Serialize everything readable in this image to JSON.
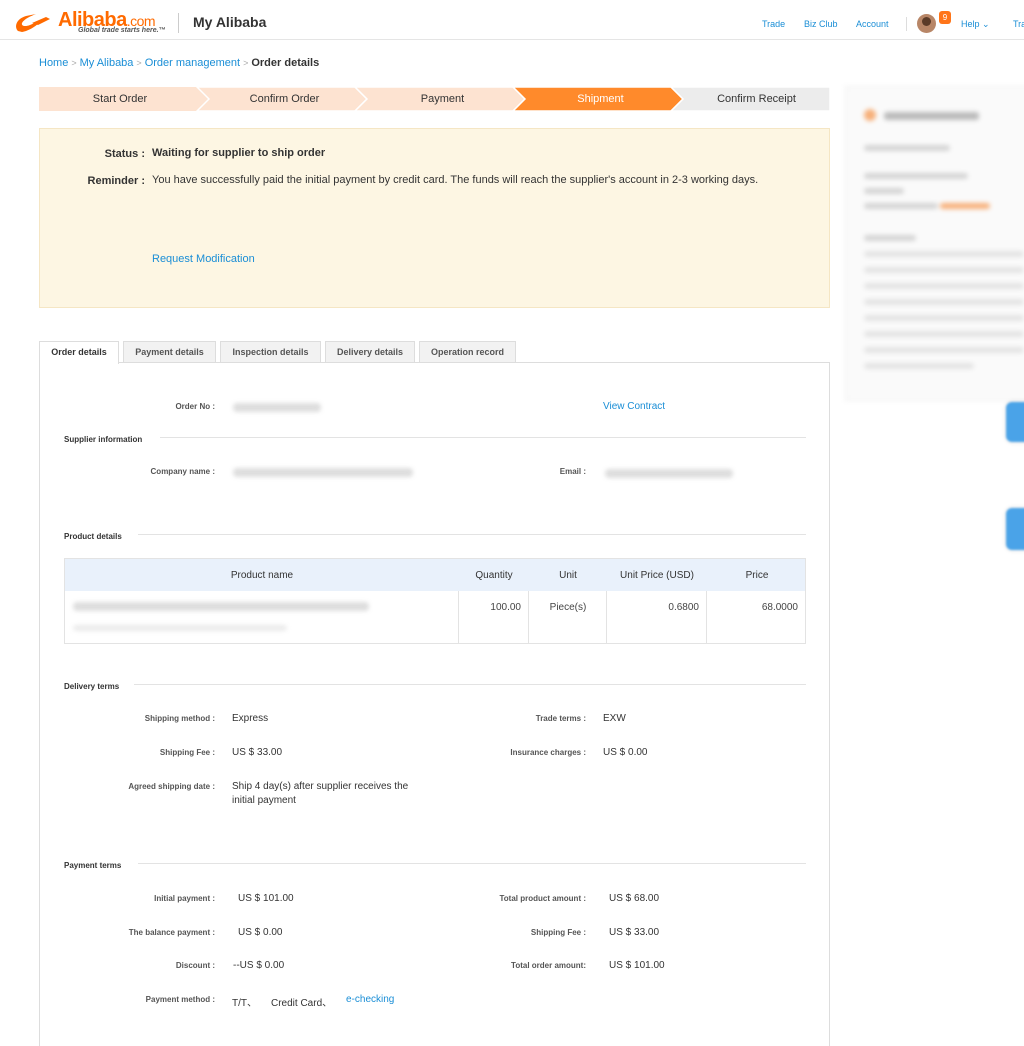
{
  "header": {
    "logo_word": "Alibaba",
    "logo_dotcom": ".com",
    "logo_tagline": "Global trade starts here.™",
    "title": "My Alibaba",
    "nav": [
      "Trade",
      "Biz Club",
      "Account"
    ],
    "notification_count": "9",
    "help_label": "Help",
    "trailing_label": "Tra"
  },
  "breadcrumb": {
    "items": [
      "Home",
      "My Alibaba",
      "Order management"
    ],
    "current": "Order details"
  },
  "steps": {
    "items": [
      "Start Order",
      "Confirm Order",
      "Payment",
      "Shipment",
      "Confirm Receipt"
    ],
    "active_index": 3,
    "colors": {
      "done": "#fde3d1",
      "active": "#ff8a2b",
      "todo": "#ececec"
    }
  },
  "status": {
    "status_label": "Status :",
    "status_value": "Waiting for supplier to ship order",
    "reminder_label": "Reminder :",
    "reminder_value": "You have successfully paid the initial payment by credit card. The funds will reach the supplier's account in 2-3 working days.",
    "request_modification": "Request Modification"
  },
  "tabs": [
    "Order details",
    "Payment details",
    "Inspection details",
    "Delivery details",
    "Operation record"
  ],
  "order": {
    "order_no_label": "Order No :",
    "view_contract": "View Contract"
  },
  "supplier": {
    "section_title": "Supplier information",
    "company_label": "Company name :",
    "email_label": "Email :"
  },
  "product": {
    "section_title": "Product details",
    "columns": [
      "Product name",
      "Quantity",
      "Unit",
      "Unit Price (USD)",
      "Price"
    ],
    "rows": [
      {
        "quantity": "100.00",
        "unit": "Piece(s)",
        "unit_price": "0.6800",
        "price": "68.0000"
      }
    ]
  },
  "delivery": {
    "section_title": "Delivery terms",
    "shipping_method_label": "Shipping method :",
    "shipping_method": "Express",
    "trade_terms_label": "Trade terms :",
    "trade_terms": "EXW",
    "shipping_fee_label": "Shipping Fee :",
    "shipping_fee": "US $ 33.00",
    "insurance_label": "Insurance charges :",
    "insurance": "US $ 0.00",
    "agreed_date_label": "Agreed shipping date :",
    "agreed_date_line1": "Ship 4 day(s) after supplier receives the",
    "agreed_date_line2": "initial payment"
  },
  "payment": {
    "section_title": "Payment terms",
    "initial_label": "Initial payment :",
    "initial": "US $ 101.00",
    "total_product_label": "Total product amount :",
    "total_product": "US $ 68.00",
    "balance_label": "The balance payment :",
    "balance": "US $ 0.00",
    "shipping_fee_label": "Shipping Fee :",
    "shipping_fee": "US $ 33.00",
    "discount_label": "Discount :",
    "discount": "--US $ 0.00",
    "total_order_label": "Total order amount:",
    "total_order": "US $ 101.00",
    "method_label": "Payment method :",
    "method_tt": "T/T、",
    "method_card": "Credit Card、",
    "method_echecking": "e-checking"
  }
}
